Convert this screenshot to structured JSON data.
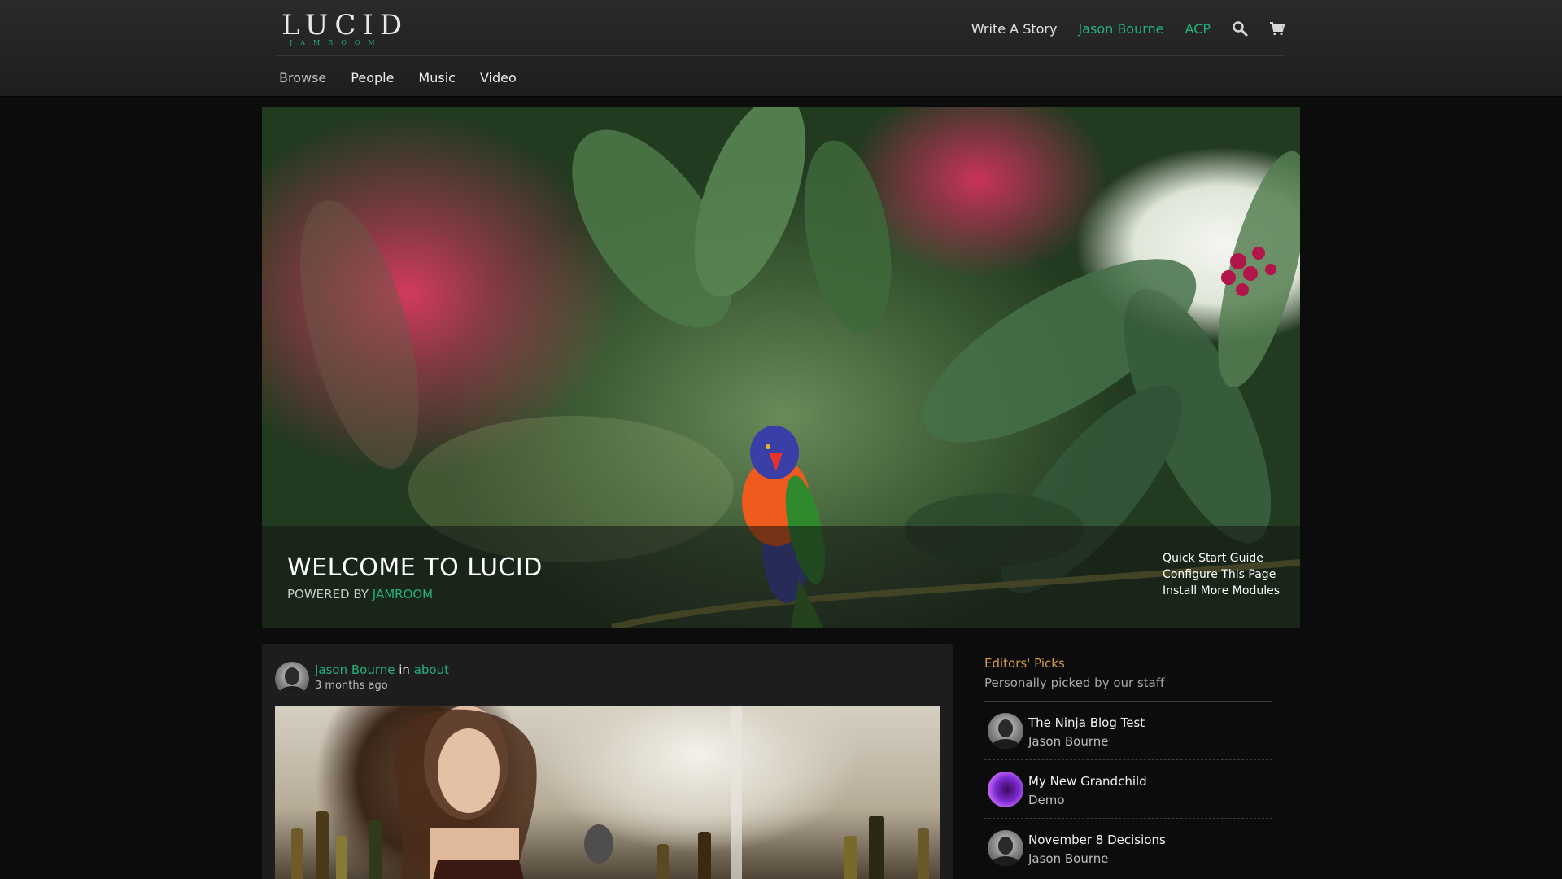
{
  "brand": {
    "logo_main": "LUCID",
    "logo_sub": "JAMROOM"
  },
  "user_nav": {
    "write_story": "Write A Story",
    "user_name": "Jason Bourne",
    "acp": "ACP",
    "search_icon": "search-icon",
    "cart_icon": "cart-icon"
  },
  "main_nav": {
    "items": [
      {
        "label": "Browse"
      },
      {
        "label": "People"
      },
      {
        "label": "Music"
      },
      {
        "label": "Video"
      }
    ]
  },
  "hero": {
    "title": "WELCOME TO LUCID",
    "subtitle_prefix": "POWERED BY ",
    "subtitle_link": "JAMROOM",
    "links": [
      {
        "label": "Quick Start Guide"
      },
      {
        "label": "Configure This Page"
      },
      {
        "label": "Install More Modules"
      }
    ]
  },
  "feed": {
    "author": "Jason Bourne",
    "in_word": " in ",
    "category": "about",
    "time": "3 months ago"
  },
  "sidebar": {
    "title": "Editors' Picks",
    "subtitle": "Personally picked by our staff",
    "picks": [
      {
        "title": "The Ninja Blog Test",
        "author": "Jason Bourne"
      },
      {
        "title": "My New Grandchild",
        "author": "Demo"
      },
      {
        "title": "November 8 Decisions",
        "author": "Jason Bourne"
      }
    ]
  },
  "colors": {
    "accent": "#23b07a",
    "sidebar_title": "#d39a4a",
    "background": "#0c0c0c"
  }
}
